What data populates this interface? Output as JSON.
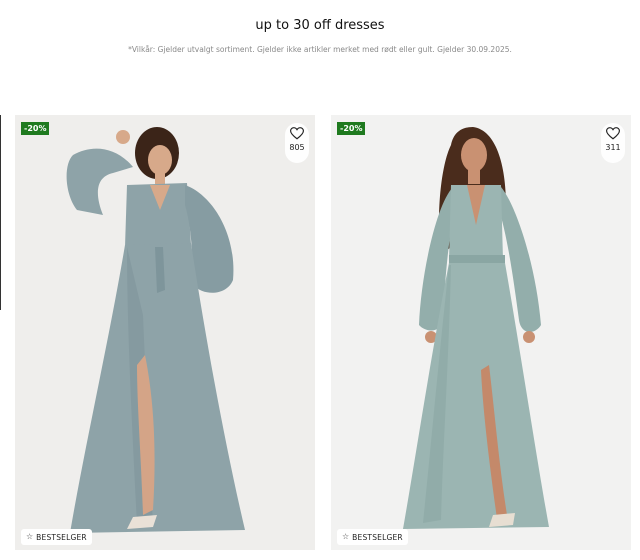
{
  "promo": {
    "title": "up to 30 off dresses",
    "terms": "*Vilkår: Gjelder utvalgt sortiment. Gjelder ikke artikler merket med rødt eller gult. Gjelder 30.09.2025."
  },
  "products": [
    {
      "discount": "-20%",
      "favorites": "805",
      "badge": "BESTSELGER",
      "badge_icon": "star-icon",
      "dress_color": "#8ea3a8"
    },
    {
      "discount": "-20%",
      "favorites": "311",
      "badge": "BESTSELGER",
      "badge_icon": "star-icon",
      "dress_color": "#9bb5b2"
    }
  ],
  "colors": {
    "discount_badge": "#1f7a1f",
    "card_background": "#efeeec"
  }
}
